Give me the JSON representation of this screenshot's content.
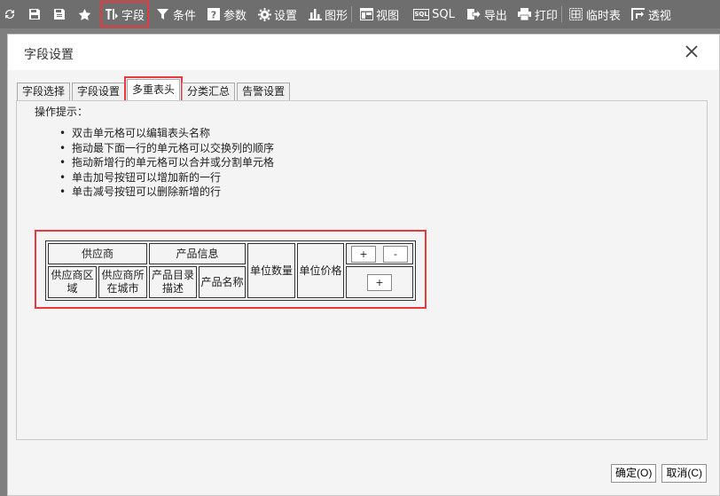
{
  "toolbar": {
    "items": [
      {
        "icon": "refresh-icon"
      },
      {
        "icon": "save-icon"
      },
      {
        "icon": "save-as-icon"
      },
      {
        "icon": "star-icon"
      },
      {
        "icon": "fields-icon",
        "label": "字段"
      },
      {
        "icon": "filter-icon",
        "label": "条件"
      },
      {
        "icon": "help-icon",
        "label": "参数"
      },
      {
        "icon": "gear-icon",
        "label": "设置"
      },
      {
        "icon": "chart-icon",
        "label": "图形"
      },
      {
        "icon": "view-icon",
        "label": "视图"
      },
      {
        "icon": "sql-icon",
        "label": "SQL",
        "badge": "SQL"
      },
      {
        "icon": "export-icon",
        "label": "导出"
      },
      {
        "icon": "print-icon",
        "label": "打印"
      },
      {
        "icon": "temp-table-icon",
        "label": "临时表"
      },
      {
        "icon": "pivot-icon",
        "label": "透视"
      }
    ]
  },
  "dialog": {
    "title": "字段设置",
    "tabs": [
      "字段选择",
      "字段设置",
      "多重表头",
      "分类汇总",
      "告警设置"
    ],
    "tips_title": "操作提示：",
    "tips": [
      "双击单元格可以编辑表头名称",
      "拖动最下面一行的单元格可以交换列的顺序",
      "拖动新增行的单元格可以合并或分割单元格",
      "单击加号按钮可以增加新的一行",
      "单击减号按钮可以删除新增的行"
    ],
    "header_grid": {
      "row1": {
        "supplier": "供应商",
        "product_info": "产品信息"
      },
      "row2": {
        "supplier_region_1": "供应商区",
        "supplier_region_2": "域",
        "supplier_city_1": "供应商所",
        "supplier_city_2": "在城市",
        "product_desc_1": "产品目录",
        "product_desc_2": "描述",
        "product_name": "产品名称"
      },
      "unit_qty": "单位数量",
      "unit_price": "单位价格",
      "plus": "+",
      "minus": "-"
    },
    "ok_label": "确定(O)",
    "cancel_label": "取消(C)"
  },
  "colors": {
    "toolbar_bg": "#6e6e6e",
    "highlight": "#e8393f",
    "dialog_bg": "#f4f4f4"
  }
}
